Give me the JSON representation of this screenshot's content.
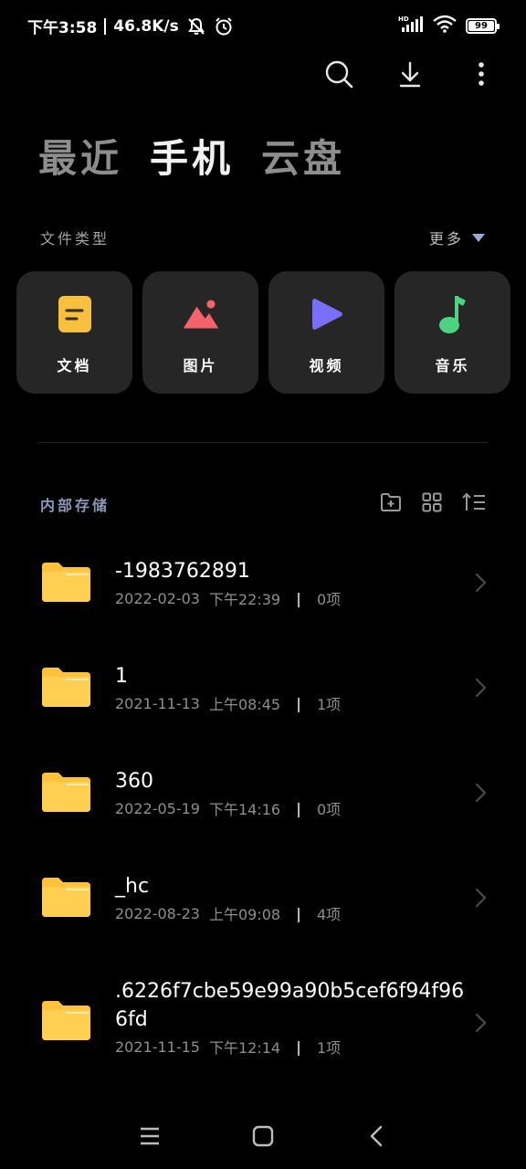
{
  "status_bar": {
    "time": "下午3:58",
    "speed": "46.8K/s",
    "battery": "99",
    "icons": [
      "mute-icon",
      "alarm-icon",
      "hd-signal-icon",
      "wifi-icon",
      "battery-icon"
    ]
  },
  "toolbar": {
    "icons": [
      "search-icon",
      "download-icon",
      "more-icon"
    ]
  },
  "tabs": [
    {
      "label": "最近",
      "active": false
    },
    {
      "label": "手机",
      "active": true
    },
    {
      "label": "云盘",
      "active": false
    }
  ],
  "file_types": {
    "title": "文件类型",
    "more_label": "更多",
    "items": [
      {
        "label": "文档",
        "icon": "document-icon",
        "color": "#f7c13f"
      },
      {
        "label": "图片",
        "icon": "image-icon",
        "color": "#f4636b"
      },
      {
        "label": "视频",
        "icon": "video-icon",
        "color": "#7a6ff7"
      },
      {
        "label": "音乐",
        "icon": "music-icon",
        "color": "#4ed382"
      }
    ]
  },
  "storage": {
    "title": "内部存储",
    "icons": [
      "new-folder-icon",
      "grid-view-icon",
      "sort-icon"
    ]
  },
  "files": [
    {
      "name": "-1983762891",
      "date": "2022-02-03",
      "time": "下午22:39",
      "count": "0项"
    },
    {
      "name": "1",
      "date": "2021-11-13",
      "time": "上午08:45",
      "count": "1项"
    },
    {
      "name": "360",
      "date": "2022-05-19",
      "time": "下午14:16",
      "count": "0项"
    },
    {
      "name": "_hc",
      "date": "2022-08-23",
      "time": "上午09:08",
      "count": "4项"
    },
    {
      "name": ".6226f7cbe59e99a90b5cef6f94f966fd",
      "date": "2021-11-15",
      "time": "下午12:14",
      "count": "1项"
    }
  ],
  "colors": {
    "background": "#000000",
    "card": "#262626",
    "folder": "#ffc23d",
    "storage_title": "#8d97b8"
  }
}
